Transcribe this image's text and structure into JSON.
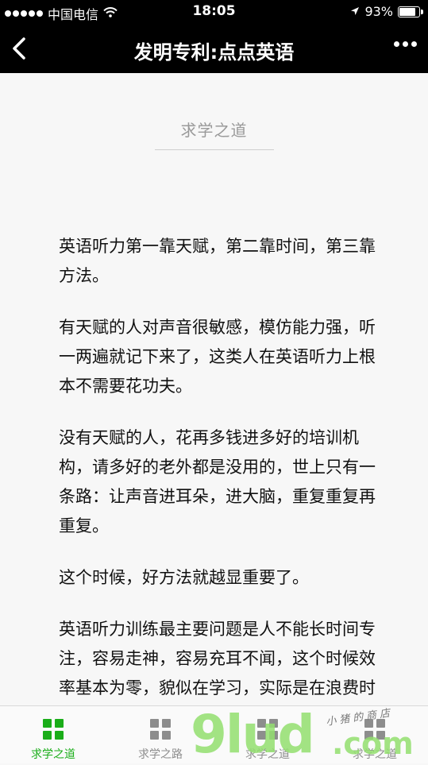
{
  "status_bar": {
    "carrier": "中国电信",
    "time": "18:05",
    "battery_percent": "93%",
    "battery_level": 0.93,
    "icons": [
      "signal-dots-icon",
      "wifi-icon",
      "location-arrow-icon",
      "battery-icon"
    ]
  },
  "nav": {
    "title": "发明专利:点点英语",
    "back_icon": "chevron-left-icon",
    "more_icon": "more-dots-icon"
  },
  "article": {
    "section_title": "求学之道",
    "paragraphs": [
      "英语听力第一靠天赋，第二靠时间，第三靠方法。",
      "有天赋的人对声音很敏感，模仿能力强，听一两遍就记下来了，这类人在英语听力上根本不需要花功夫。",
      "没有天赋的人，花再多钱进多好的培训机构，请多好的老外都是没用的，世上只有一条路：让声音进耳朵，进大脑，重复重复再重复。",
      "这个时候，好方法就越显重要了。",
      "英语听力训练最主要问题是人不能长时间专注，容易走神，容易充耳不闻，这个时候效率基本为零，貌似在学习，实际是在浪费时间。"
    ]
  },
  "tabs": [
    {
      "label": "求学之道",
      "active": true
    },
    {
      "label": "求学之路",
      "active": false
    },
    {
      "label": "求学之道",
      "active": false
    },
    {
      "label": "求学之道",
      "active": false
    }
  ],
  "watermark": {
    "main": "9lud",
    "domain": ".com",
    "small": "小猪的商店"
  },
  "colors": {
    "accent": "#1aad19",
    "inactive": "#8d8d8d",
    "bar_background": "#000000",
    "page_background": "#f7f7f7"
  }
}
